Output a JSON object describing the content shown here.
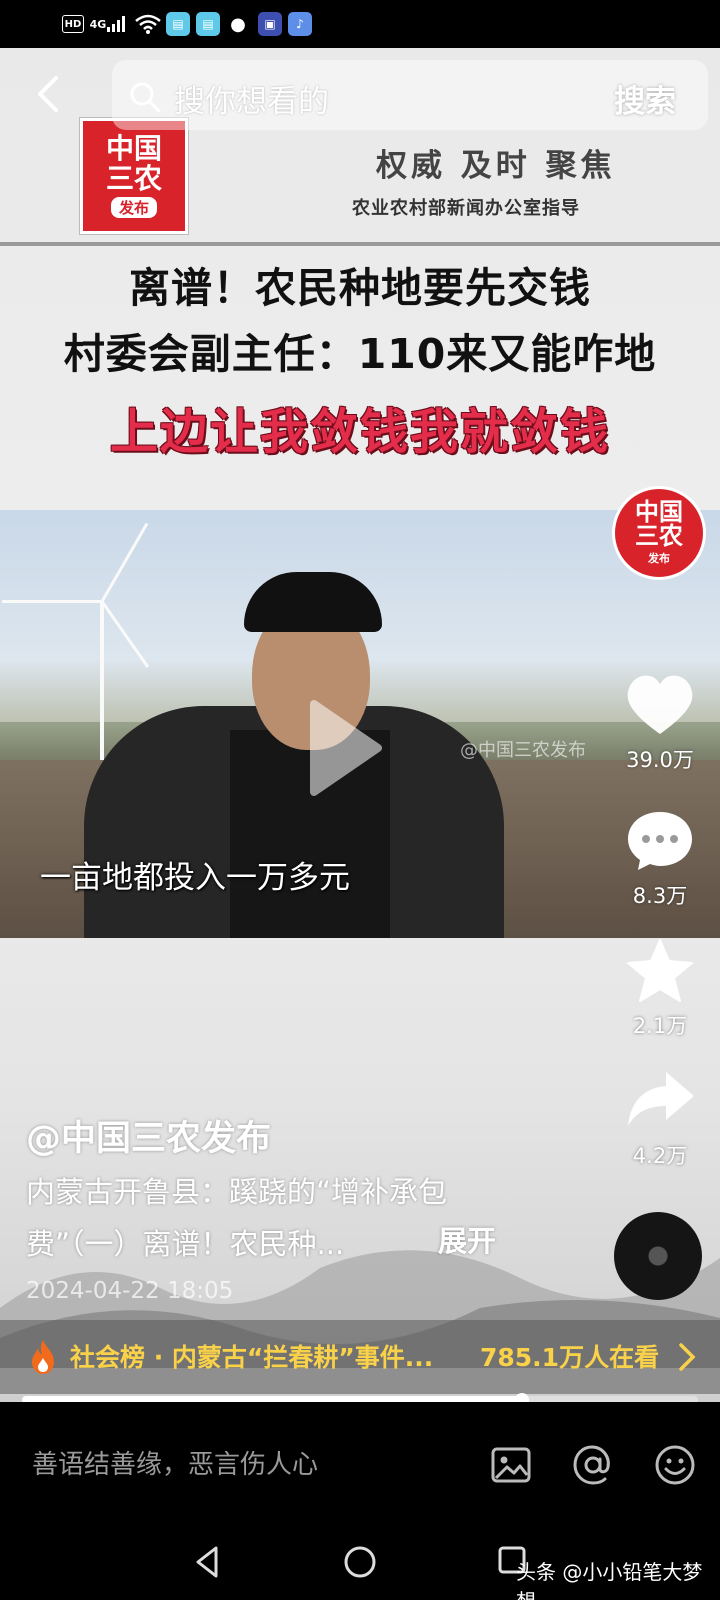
{
  "status_bar": {
    "hd": "HD",
    "network": "4G",
    "app_icons": [
      "book-app-icon",
      "book-app-icon",
      "wechat-icon",
      "tieba-icon",
      "music-app-icon"
    ]
  },
  "search": {
    "placeholder": "搜你想看的",
    "button": "搜索"
  },
  "banner": {
    "logo_line1": "中国",
    "logo_line2": "三农",
    "logo_line3": "发布",
    "slogan": "权威 及时 聚焦",
    "subtitle": "农业农村部新闻办公室指导"
  },
  "headlines": {
    "line1": "离谱！农民种地要先交钱",
    "line2": "村委会副主任：110来又能咋地",
    "line3": "上边让我敛钱我就敛钱"
  },
  "video": {
    "watermark": "@中国三农发布",
    "subtitle": "一亩地都投入一万多元",
    "progress": 0.74
  },
  "actions": {
    "avatar_line1": "中国",
    "avatar_line2": "三农",
    "avatar_line3": "发布",
    "likes": "39.0万",
    "comments": "8.3万",
    "favorites": "2.1万",
    "shares": "4.2万"
  },
  "caption": {
    "author": "@中国三农发布",
    "description_line1": "内蒙古开鲁县：蹊跷的“增补承包",
    "description_line2": "费”（一）离谱！农民种...",
    "expand": "展开",
    "date": "2024-04-22 18:05"
  },
  "trending": {
    "text": "社会榜 · 内蒙古“拦春耕”事件...",
    "count": "785.1万人在看"
  },
  "comment_bar": {
    "placeholder": "善语结善缘，恶言伤人心"
  },
  "nav": {
    "source_mark": "头条 @小小铅笔大梦想"
  },
  "colors": {
    "brand_red": "#d8232a",
    "headline_red": "#e32d4a",
    "trending_yellow": "#f9d24a"
  }
}
